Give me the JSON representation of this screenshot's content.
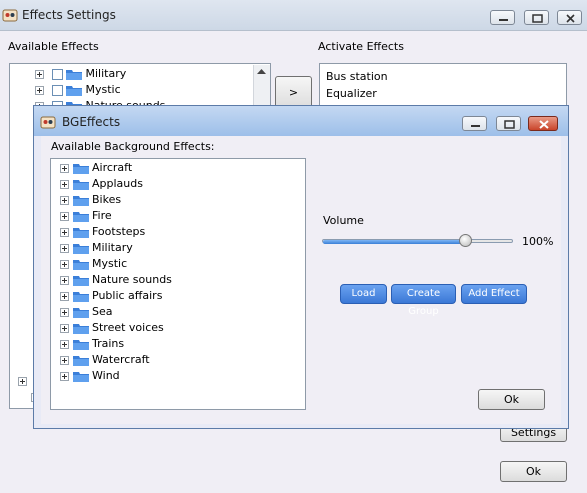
{
  "outer": {
    "title": "Effects Settings",
    "available_label": "Available Effects",
    "activate_label": "Activate Effects",
    "tree_items": [
      {
        "label": "Military"
      },
      {
        "label": "Mystic"
      },
      {
        "label": "Nature sounds"
      }
    ],
    "active_effects": [
      "Bus station",
      "Equalizer"
    ],
    "move_button": ">",
    "settings_button": "Settings",
    "ok_button": "Ok"
  },
  "dialog": {
    "title": "BGEffects",
    "available_label": "Available Background Effects:",
    "effects": [
      "Aircraft",
      "Applauds",
      "Bikes",
      "Fire",
      "Footsteps",
      "Military",
      "Mystic",
      "Nature sounds",
      "Public affairs",
      "Sea",
      "Street voices",
      "Trains",
      "Watercraft",
      "Wind"
    ],
    "volume_label": "Volume",
    "volume_value": "100%",
    "volume_level": 0.75,
    "load_button": "Load",
    "create_group_button": "Create Group",
    "add_effect_button": "Add Effect",
    "ok_button": "Ok"
  },
  "colors": {
    "folder_blue": "#3b7fd9",
    "accent_button": "#3b78d6",
    "close_button": "#c9442a"
  }
}
